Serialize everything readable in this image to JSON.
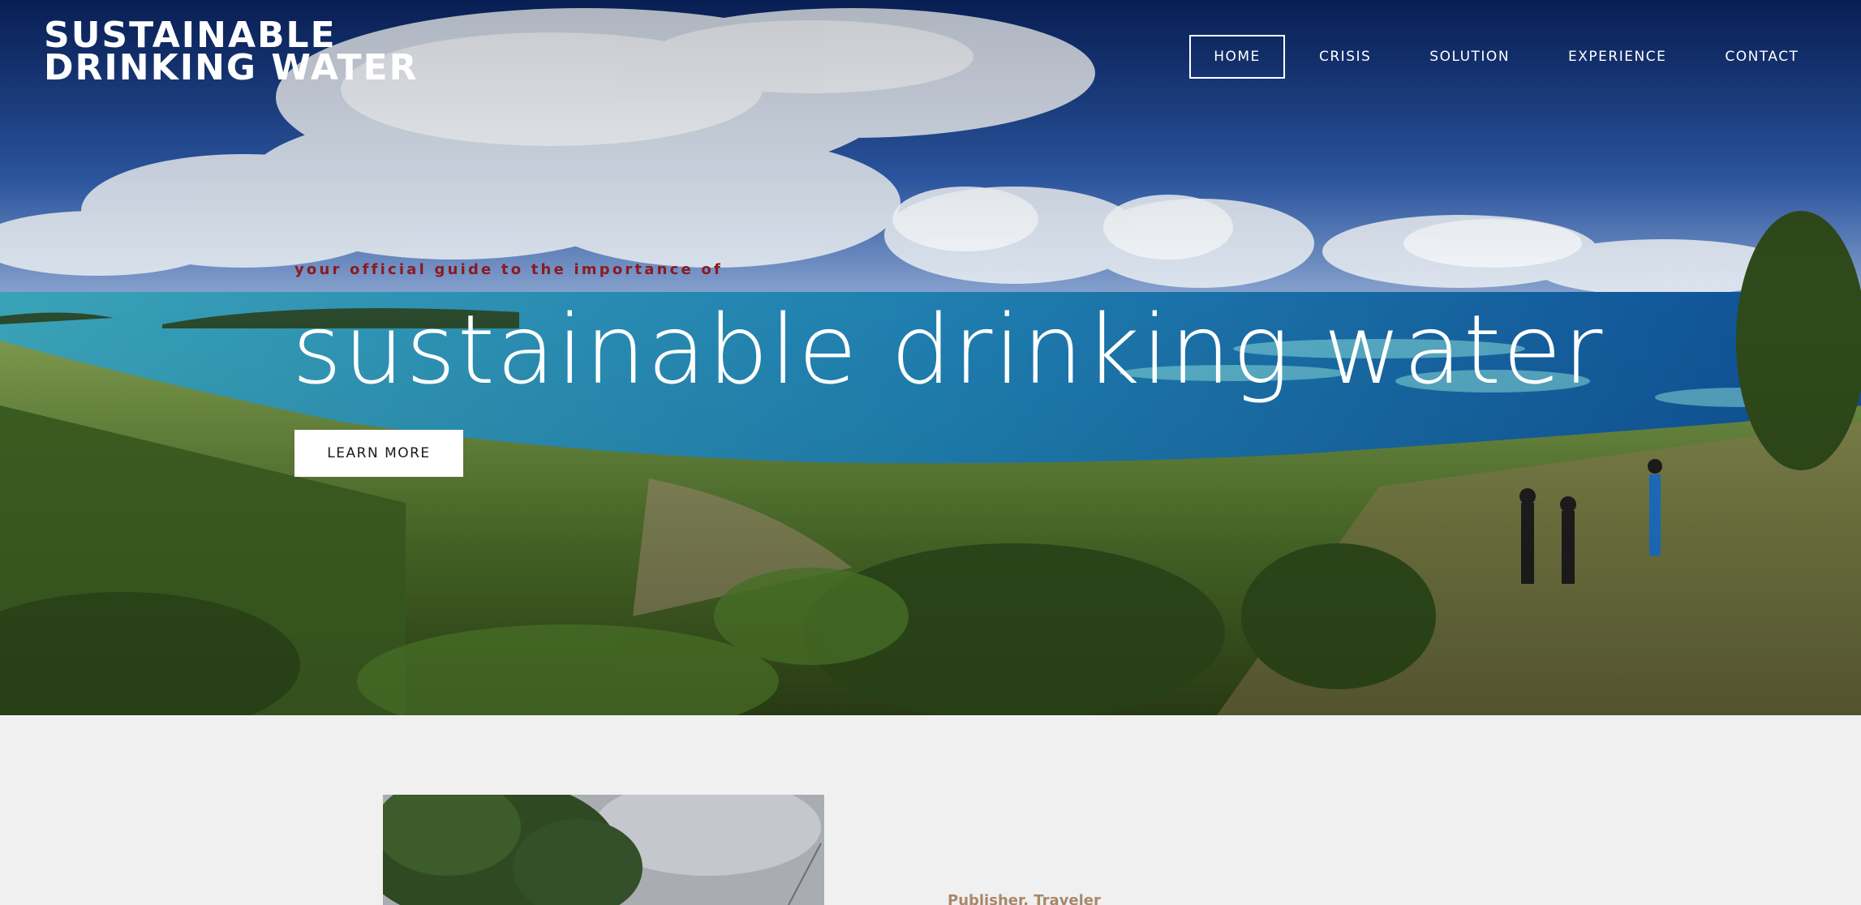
{
  "site": {
    "title_line1": "SUSTAINABLE",
    "title_line2": "DRINKING WATER"
  },
  "nav": {
    "items": [
      {
        "label": "HOME",
        "active": true
      },
      {
        "label": "CRISIS",
        "active": false
      },
      {
        "label": "SOLUTION",
        "active": false
      },
      {
        "label": "EXPERIENCE",
        "active": false
      },
      {
        "label": "CONTACT",
        "active": false
      }
    ]
  },
  "hero": {
    "tagline": "your official guide to the importance of",
    "headline": "sustainable drinking water",
    "cta_label": "LEARN MORE",
    "image": "hilltop-view-of-coastal-lagoon-with-hikers"
  },
  "about": {
    "role": "Publisher, Traveler",
    "image": "tree-under-cloudy-sky-photo"
  },
  "colors": {
    "tagline": "#8b1a1f",
    "role": "#a8876a",
    "section_bg": "#f0f0f0",
    "nav_text": "#ffffff"
  }
}
